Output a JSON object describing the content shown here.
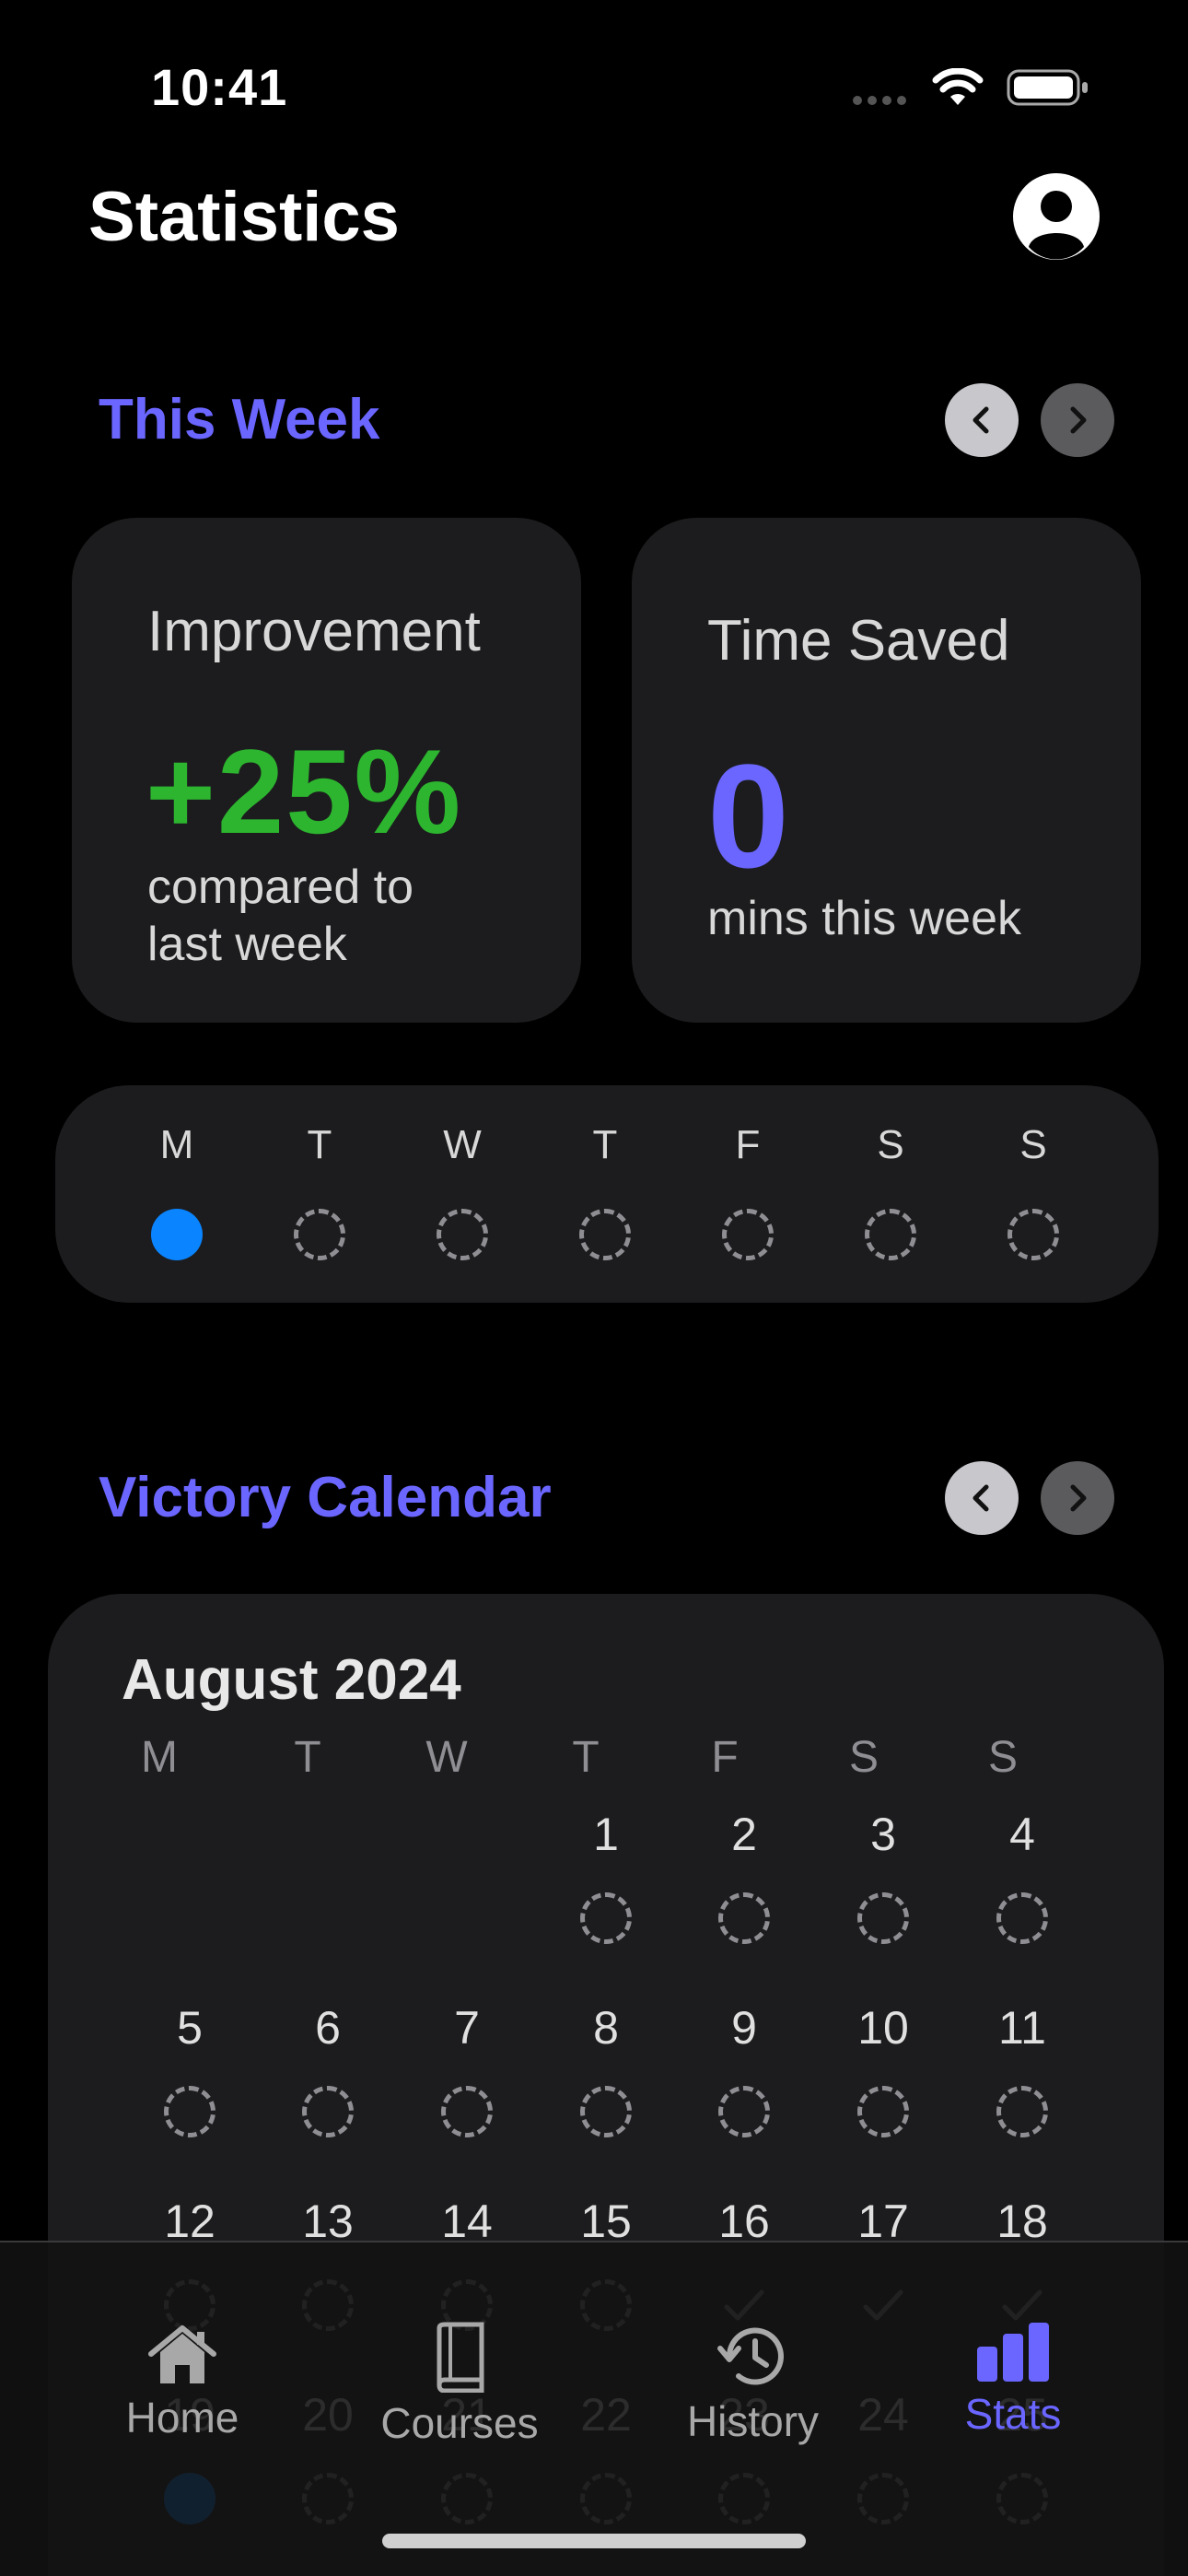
{
  "status_bar": {
    "time": "10:41"
  },
  "header": {
    "title": "Statistics"
  },
  "this_week": {
    "title": "This Week",
    "improvement": {
      "label": "Improvement",
      "value": "+25%",
      "sub_line1": "compared to",
      "sub_line2": "last week"
    },
    "time_saved": {
      "label": "Time Saved",
      "value": "0",
      "sub": "mins this week"
    },
    "days": [
      {
        "letter": "M",
        "state": "completed"
      },
      {
        "letter": "T",
        "state": "empty"
      },
      {
        "letter": "W",
        "state": "empty"
      },
      {
        "letter": "T",
        "state": "empty"
      },
      {
        "letter": "F",
        "state": "empty"
      },
      {
        "letter": "S",
        "state": "empty"
      },
      {
        "letter": "S",
        "state": "empty"
      }
    ]
  },
  "victory_calendar": {
    "title": "Victory Calendar",
    "month": "August 2024",
    "weekdays": [
      "M",
      "T",
      "W",
      "T",
      "F",
      "S",
      "S"
    ],
    "days": [
      {
        "num": "1",
        "state": "empty"
      },
      {
        "num": "2",
        "state": "empty"
      },
      {
        "num": "3",
        "state": "empty"
      },
      {
        "num": "4",
        "state": "empty"
      },
      {
        "num": "5",
        "state": "empty"
      },
      {
        "num": "6",
        "state": "empty"
      },
      {
        "num": "7",
        "state": "empty"
      },
      {
        "num": "8",
        "state": "empty"
      },
      {
        "num": "9",
        "state": "empty"
      },
      {
        "num": "10",
        "state": "empty"
      },
      {
        "num": "11",
        "state": "empty"
      },
      {
        "num": "12",
        "state": "empty"
      },
      {
        "num": "13",
        "state": "empty"
      },
      {
        "num": "14",
        "state": "empty"
      },
      {
        "num": "15",
        "state": "empty"
      },
      {
        "num": "16",
        "state": "check"
      },
      {
        "num": "17",
        "state": "check"
      },
      {
        "num": "18",
        "state": "check"
      },
      {
        "num": "19",
        "state": "completed"
      },
      {
        "num": "20",
        "state": "empty"
      },
      {
        "num": "21",
        "state": "empty"
      },
      {
        "num": "22",
        "state": "empty"
      },
      {
        "num": "23",
        "state": "empty"
      },
      {
        "num": "24",
        "state": "empty"
      },
      {
        "num": "25",
        "state": "empty"
      }
    ]
  },
  "tabs": [
    {
      "label": "Home",
      "icon": "house-icon",
      "active": false
    },
    {
      "label": "Courses",
      "icon": "book-icon",
      "active": false
    },
    {
      "label": "History",
      "icon": "history-clock-icon",
      "active": false
    },
    {
      "label": "Stats",
      "icon": "bar-chart-icon",
      "active": true
    }
  ],
  "colors": {
    "accent": "#6a66ff",
    "positive": "#2db52f",
    "completed_dot": "#0a84ff",
    "card_bg": "#1c1c1e"
  }
}
